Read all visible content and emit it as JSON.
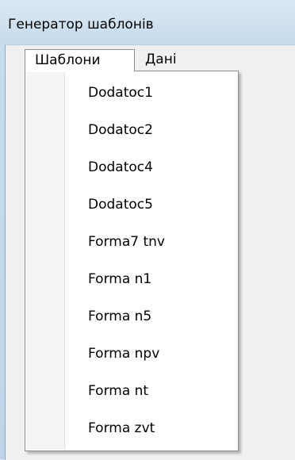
{
  "window": {
    "title": "Генератор шаблонів"
  },
  "menubar": {
    "items": [
      {
        "label": "Шаблони",
        "state": "open"
      },
      {
        "label": "Дані",
        "state": "closed"
      }
    ]
  },
  "dropdown": {
    "items": [
      {
        "label": "Dodatoc1"
      },
      {
        "label": "Dodatoc2"
      },
      {
        "label": "Dodatoc4"
      },
      {
        "label": "Dodatoc5"
      },
      {
        "label": "Forma7 tnv"
      },
      {
        "label": "Forma n1"
      },
      {
        "label": "Forma n5"
      },
      {
        "label": "Forma npv"
      },
      {
        "label": "Forma nt"
      },
      {
        "label": "Forma zvt"
      }
    ]
  },
  "colors": {
    "title_bar": "#cfe0ef",
    "client_background": "#f0f0f0",
    "menu_background": "#ffffff",
    "menu_border": "#8f8f8f"
  }
}
